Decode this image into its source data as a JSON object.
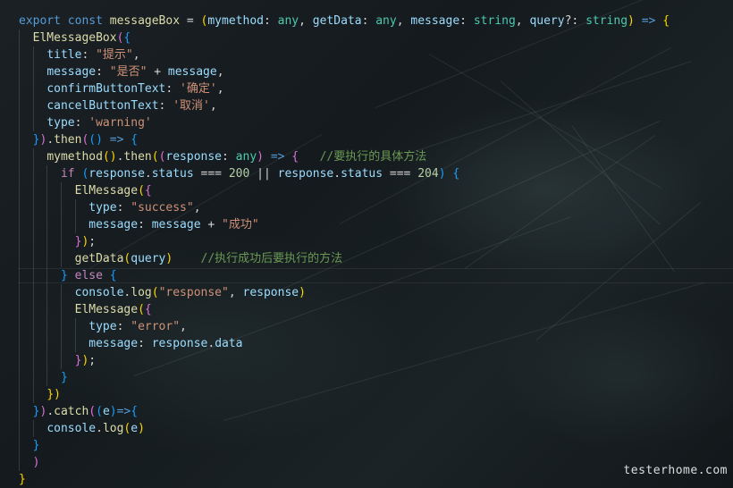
{
  "editor": {
    "watermark": "testerhome.com"
  },
  "code": {
    "lines": [
      [
        [
          "kw",
          "export"
        ],
        [
          "op",
          " "
        ],
        [
          "kw",
          "const"
        ],
        [
          "op",
          " "
        ],
        [
          "fn",
          "messageBox"
        ],
        [
          "op",
          " = "
        ],
        [
          "b1",
          "("
        ],
        [
          "var",
          "mymethod"
        ],
        [
          "op",
          ": "
        ],
        [
          "ty",
          "any"
        ],
        [
          "op",
          ", "
        ],
        [
          "var",
          "getData"
        ],
        [
          "op",
          ": "
        ],
        [
          "ty",
          "any"
        ],
        [
          "op",
          ", "
        ],
        [
          "var",
          "message"
        ],
        [
          "op",
          ": "
        ],
        [
          "ty",
          "string"
        ],
        [
          "op",
          ", "
        ],
        [
          "var",
          "query"
        ],
        [
          "op",
          "?: "
        ],
        [
          "ty",
          "string"
        ],
        [
          "b1",
          ")"
        ],
        [
          "op",
          " "
        ],
        [
          "kw",
          "=>"
        ],
        [
          "op",
          " "
        ],
        [
          "b1",
          "{"
        ]
      ],
      [
        [
          "op",
          "  "
        ],
        [
          "fn",
          "ElMessageBox"
        ],
        [
          "b2",
          "("
        ],
        [
          "b3",
          "{"
        ]
      ],
      [
        [
          "op",
          "    "
        ],
        [
          "var",
          "title"
        ],
        [
          "op",
          ": "
        ],
        [
          "str",
          "\"提示\""
        ],
        [
          "op",
          ","
        ]
      ],
      [
        [
          "op",
          "    "
        ],
        [
          "var",
          "message"
        ],
        [
          "op",
          ": "
        ],
        [
          "str",
          "\"是否\""
        ],
        [
          "op",
          " + "
        ],
        [
          "var",
          "message"
        ],
        [
          "op",
          ","
        ]
      ],
      [
        [
          "op",
          "    "
        ],
        [
          "var",
          "confirmButtonText"
        ],
        [
          "op",
          ": "
        ],
        [
          "str",
          "'确定'"
        ],
        [
          "op",
          ","
        ]
      ],
      [
        [
          "op",
          "    "
        ],
        [
          "var",
          "cancelButtonText"
        ],
        [
          "op",
          ": "
        ],
        [
          "str",
          "'取消'"
        ],
        [
          "op",
          ","
        ]
      ],
      [
        [
          "op",
          "    "
        ],
        [
          "var",
          "type"
        ],
        [
          "op",
          ": "
        ],
        [
          "str",
          "'warning'"
        ]
      ],
      [
        [
          "op",
          "  "
        ],
        [
          "b3",
          "}"
        ],
        [
          "b2",
          ")"
        ],
        [
          "op",
          "."
        ],
        [
          "fn",
          "then"
        ],
        [
          "b2",
          "("
        ],
        [
          "b3",
          "("
        ],
        [
          "b3",
          ")"
        ],
        [
          "op",
          " "
        ],
        [
          "kw",
          "=>"
        ],
        [
          "op",
          " "
        ],
        [
          "b3",
          "{"
        ]
      ],
      [
        [
          "op",
          "    "
        ],
        [
          "fn",
          "mymethod"
        ],
        [
          "b1",
          "("
        ],
        [
          "b1",
          ")"
        ],
        [
          "op",
          "."
        ],
        [
          "fn",
          "then"
        ],
        [
          "b1",
          "("
        ],
        [
          "b2",
          "("
        ],
        [
          "var",
          "response"
        ],
        [
          "op",
          ": "
        ],
        [
          "ty",
          "any"
        ],
        [
          "b2",
          ")"
        ],
        [
          "op",
          " "
        ],
        [
          "kw",
          "=>"
        ],
        [
          "op",
          " "
        ],
        [
          "b2",
          "{"
        ],
        [
          "op",
          "   "
        ],
        [
          "cmt",
          "//要执行的具体方法"
        ]
      ],
      [
        [
          "op",
          "      "
        ],
        [
          "ctl",
          "if"
        ],
        [
          "op",
          " "
        ],
        [
          "b3",
          "("
        ],
        [
          "var",
          "response"
        ],
        [
          "op",
          "."
        ],
        [
          "var",
          "status"
        ],
        [
          "op",
          " === "
        ],
        [
          "num",
          "200"
        ],
        [
          "op",
          " || "
        ],
        [
          "var",
          "response"
        ],
        [
          "op",
          "."
        ],
        [
          "var",
          "status"
        ],
        [
          "op",
          " === "
        ],
        [
          "num",
          "204"
        ],
        [
          "b3",
          ")"
        ],
        [
          "op",
          " "
        ],
        [
          "b3",
          "{"
        ]
      ],
      [
        [
          "op",
          "        "
        ],
        [
          "fn",
          "ElMessage"
        ],
        [
          "b1",
          "("
        ],
        [
          "b2",
          "{"
        ]
      ],
      [
        [
          "op",
          "          "
        ],
        [
          "var",
          "type"
        ],
        [
          "op",
          ": "
        ],
        [
          "str",
          "\"success\""
        ],
        [
          "op",
          ","
        ]
      ],
      [
        [
          "op",
          "          "
        ],
        [
          "var",
          "message"
        ],
        [
          "op",
          ": "
        ],
        [
          "var",
          "message"
        ],
        [
          "op",
          " + "
        ],
        [
          "str",
          "\"成功\""
        ]
      ],
      [
        [
          "op",
          "        "
        ],
        [
          "b2",
          "}"
        ],
        [
          "b1",
          ")"
        ],
        [
          "op",
          ";"
        ]
      ],
      [
        [
          "op",
          "        "
        ],
        [
          "fn",
          "getData"
        ],
        [
          "b1",
          "("
        ],
        [
          "var",
          "query"
        ],
        [
          "b1",
          ")"
        ],
        [
          "op",
          "    "
        ],
        [
          "cmt",
          "//执行成功后要执行的方法"
        ]
      ],
      [
        [
          "op",
          "      "
        ],
        [
          "b3",
          "}"
        ],
        [
          "op",
          " "
        ],
        [
          "ctl",
          "else"
        ],
        [
          "op",
          " "
        ],
        [
          "b3",
          "{"
        ]
      ],
      [
        [
          "op",
          "        "
        ],
        [
          "var",
          "console"
        ],
        [
          "op",
          "."
        ],
        [
          "fn",
          "log"
        ],
        [
          "b1",
          "("
        ],
        [
          "str",
          "\"response\""
        ],
        [
          "op",
          ", "
        ],
        [
          "var",
          "response"
        ],
        [
          "b1",
          ")"
        ]
      ],
      [
        [
          "op",
          "        "
        ],
        [
          "fn",
          "ElMessage"
        ],
        [
          "b1",
          "("
        ],
        [
          "b2",
          "{"
        ]
      ],
      [
        [
          "op",
          "          "
        ],
        [
          "var",
          "type"
        ],
        [
          "op",
          ": "
        ],
        [
          "str",
          "\"error\""
        ],
        [
          "op",
          ","
        ]
      ],
      [
        [
          "op",
          "          "
        ],
        [
          "var",
          "message"
        ],
        [
          "op",
          ": "
        ],
        [
          "var",
          "response"
        ],
        [
          "op",
          "."
        ],
        [
          "var",
          "data"
        ]
      ],
      [
        [
          "op",
          "        "
        ],
        [
          "b2",
          "}"
        ],
        [
          "b1",
          ")"
        ],
        [
          "op",
          ";"
        ]
      ],
      [
        [
          "op",
          "      "
        ],
        [
          "b3",
          "}"
        ]
      ],
      [
        [
          "op",
          "    "
        ],
        [
          "b1",
          "}"
        ],
        [
          "b1",
          ")"
        ]
      ],
      [
        [
          "op",
          "  "
        ],
        [
          "b3",
          "}"
        ],
        [
          "b2",
          ")"
        ],
        [
          "op",
          "."
        ],
        [
          "fn",
          "catch"
        ],
        [
          "b2",
          "("
        ],
        [
          "b3",
          "("
        ],
        [
          "var",
          "e"
        ],
        [
          "b3",
          ")"
        ],
        [
          "kw",
          "=>"
        ],
        [
          "b3",
          "{"
        ]
      ],
      [
        [
          "op",
          "    "
        ],
        [
          "var",
          "console"
        ],
        [
          "op",
          "."
        ],
        [
          "fn",
          "log"
        ],
        [
          "b1",
          "("
        ],
        [
          "var",
          "e"
        ],
        [
          "b1",
          ")"
        ]
      ],
      [
        [
          "op",
          "  "
        ],
        [
          "b3",
          "}"
        ]
      ],
      [
        [
          "op",
          "  "
        ],
        [
          "b2",
          ")"
        ]
      ],
      [
        [
          "b1",
          "}"
        ]
      ]
    ],
    "guides": [
      [],
      [
        1
      ],
      [
        1,
        2
      ],
      [
        1,
        2
      ],
      [
        1,
        2
      ],
      [
        1,
        2
      ],
      [
        1,
        2
      ],
      [
        1
      ],
      [
        1,
        2
      ],
      [
        1,
        2,
        3
      ],
      [
        1,
        2,
        3,
        4
      ],
      [
        1,
        2,
        3,
        4,
        5
      ],
      [
        1,
        2,
        3,
        4,
        5
      ],
      [
        1,
        2,
        3,
        4
      ],
      [
        1,
        2,
        3,
        4
      ],
      [
        1,
        2,
        3
      ],
      [
        1,
        2,
        3,
        4
      ],
      [
        1,
        2,
        3,
        4
      ],
      [
        1,
        2,
        3,
        4,
        5
      ],
      [
        1,
        2,
        3,
        4,
        5
      ],
      [
        1,
        2,
        3,
        4
      ],
      [
        1,
        2,
        3
      ],
      [
        1,
        2
      ],
      [
        1
      ],
      [
        1,
        2
      ],
      [
        1
      ],
      [
        1
      ],
      []
    ]
  }
}
